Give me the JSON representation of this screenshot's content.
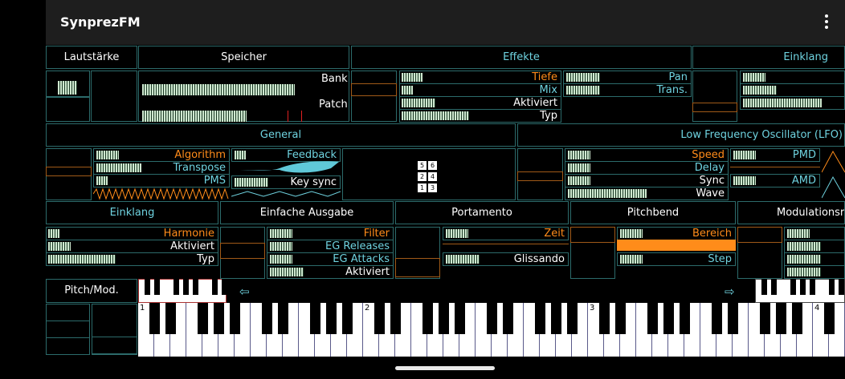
{
  "app": {
    "title": "SynprezFM",
    "menu_icon": "more-vert-icon"
  },
  "sections": {
    "lautstaerke": "Lautstärke",
    "speicher": "Speicher",
    "effekte": "Effekte",
    "einklang_top": "Einklang",
    "general": "General",
    "lfo": "Low Frequency Oscillator (LFO)",
    "einklang": "Einklang",
    "einfache_ausgabe": "Einfache Ausgabe",
    "portamento": "Portamento",
    "pitchbend": "Pitchbend",
    "modulationsrad": "Modulationsra",
    "pitch_mod": "Pitch/Mod."
  },
  "speicher": {
    "bank": "Bank",
    "patch": "Patch"
  },
  "effekte": {
    "tiefe": "Tiefe",
    "mix": "Mix",
    "aktiviert": "Aktiviert",
    "typ": "Typ",
    "pan": "Pan",
    "trans": "Trans."
  },
  "general": {
    "algorithm": "Algorithm",
    "transpose": "Transpose",
    "pms": "PMS",
    "feedback": "Feedback",
    "key_sync": "Key sync",
    "algo_ops": [
      "5",
      "6",
      "2",
      "4",
      "1",
      "3"
    ]
  },
  "lfo": {
    "speed": "Speed",
    "delay": "Delay",
    "sync": "Sync",
    "wave": "Wave",
    "pmd": "PMD",
    "amd": "AMD"
  },
  "einklang": {
    "harmonie": "Harmonie",
    "aktiviert": "Aktiviert",
    "typ": "Typ"
  },
  "einfache_ausgabe": {
    "filter": "Filter",
    "eg_releases": "EG Releases",
    "eg_attacks": "EG Attacks",
    "aktiviert": "Aktiviert"
  },
  "portamento": {
    "zeit": "Zeit",
    "glissando": "Glissando"
  },
  "pitchbend": {
    "bereich": "Bereich",
    "step": "Step"
  },
  "keyboard": {
    "octaves": [
      "1",
      "2",
      "3",
      "4"
    ],
    "left_arrow": "⇦",
    "right_arrow": "⇨"
  },
  "colors": {
    "accent_cyan": "#6fd3e0",
    "accent_orange": "#ff8c1a",
    "border": "#2c6b6b",
    "topbar": "#1e1e1e"
  }
}
